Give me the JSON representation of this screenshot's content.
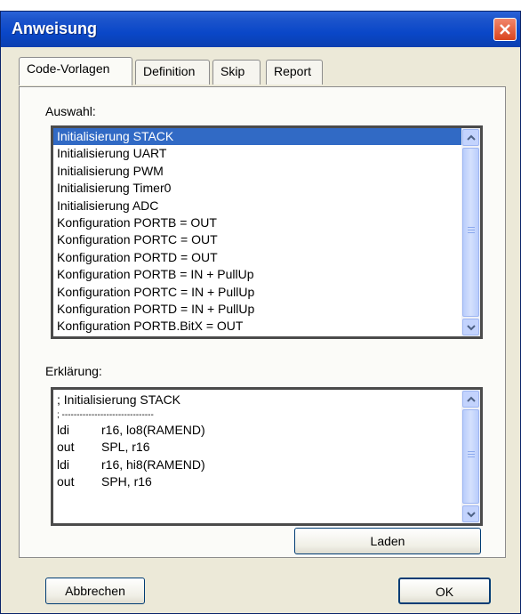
{
  "window": {
    "title": "Anweisung"
  },
  "tabs": [
    {
      "label": "Code-Vorlagen",
      "active": true
    },
    {
      "label": "Definition",
      "active": false
    },
    {
      "label": "Skip",
      "active": false
    },
    {
      "label": "Report",
      "active": false
    }
  ],
  "auswahl": {
    "label": "Auswahl:",
    "selected_index": 0,
    "items": [
      "Initialisierung STACK",
      "Initialisierung UART",
      "Initialisierung PWM",
      "Initialisierung Timer0",
      "Initialisierung ADC",
      "Konfiguration PORTB = OUT",
      "Konfiguration PORTC = OUT",
      "Konfiguration PORTD = OUT",
      "Konfiguration PORTB = IN + PullUp",
      "Konfiguration PORTC = IN + PullUp",
      "Konfiguration PORTD = IN + PullUp",
      "Konfiguration PORTB.BitX = OUT"
    ]
  },
  "erklaerung": {
    "label": "Erklärung:",
    "comment_line": "; Initialisierung STACK",
    "separator_line": "; -------------------------------",
    "lines": [
      {
        "op": "ldi",
        "args": "r16, lo8(RAMEND)"
      },
      {
        "op": "out",
        "args": "SPL, r16"
      },
      {
        "op": "ldi",
        "args": "r16, hi8(RAMEND)"
      },
      {
        "op": "out",
        "args": "SPH, r16"
      }
    ]
  },
  "buttons": {
    "laden": "Laden",
    "abbrechen": "Abbrechen",
    "ok": "OK"
  }
}
